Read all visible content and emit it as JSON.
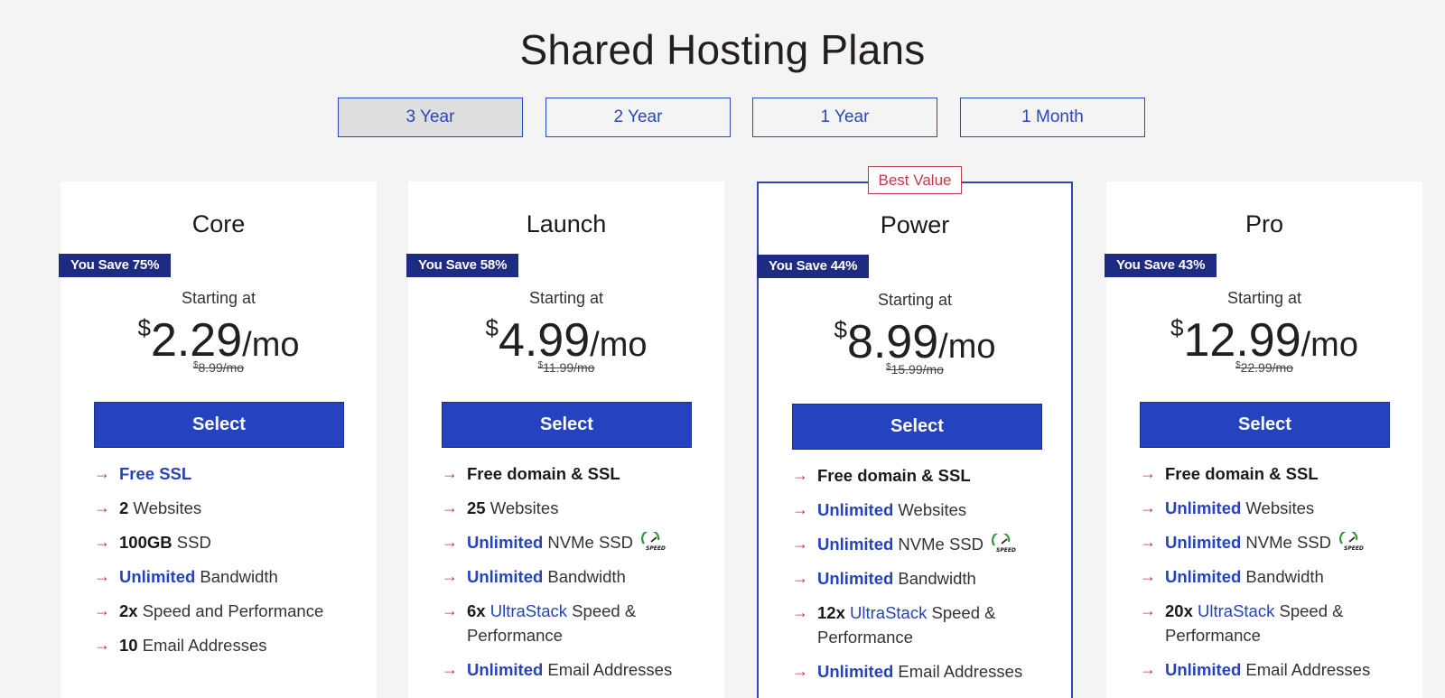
{
  "page_title": "Shared Hosting Plans",
  "terms": [
    "3 Year",
    "2 Year",
    "1 Year",
    "1 Month"
  ],
  "active_term": "3 Year",
  "best_value_label": "Best Value",
  "starting_label": "Starting at",
  "currency": "$",
  "per_label": "/mo",
  "select_label": "Select",
  "plans": [
    {
      "name": "Core",
      "save": "You Save 75%",
      "price": "2.29",
      "old_price": "8.99/mo",
      "features": [
        {
          "bold": "Free SSL",
          "bold_blue": true,
          "rest": ""
        },
        {
          "bold": "2",
          "bold_blue": false,
          "rest": " Websites"
        },
        {
          "bold": "100GB",
          "bold_blue": false,
          "rest": " SSD"
        },
        {
          "bold": "Unlimited",
          "bold_blue": true,
          "rest": " Bandwidth"
        },
        {
          "bold": "2x",
          "bold_blue": false,
          "rest": " Speed and Performance"
        },
        {
          "bold": "10",
          "bold_blue": false,
          "rest": " Email Addresses"
        }
      ]
    },
    {
      "name": "Launch",
      "save": "You Save 58%",
      "price": "4.99",
      "old_price": "11.99/mo",
      "features": [
        {
          "bold": "Free domain & SSL",
          "bold_blue": false,
          "rest": ""
        },
        {
          "bold": "25",
          "bold_blue": false,
          "rest": " Websites"
        },
        {
          "bold": "Unlimited",
          "bold_blue": true,
          "rest": " NVMe SSD",
          "speed_icon": true
        },
        {
          "bold": "Unlimited",
          "bold_blue": true,
          "rest": " Bandwidth"
        },
        {
          "bold": "6x",
          "bold_blue": false,
          "link": "UltraStack",
          "rest": " Speed & Performance"
        },
        {
          "bold": "Unlimited",
          "bold_blue": true,
          "rest": " Email Addresses"
        }
      ]
    },
    {
      "name": "Power",
      "save": "You Save 44%",
      "price": "8.99",
      "old_price": "15.99/mo",
      "featured": true,
      "features": [
        {
          "bold": "Free domain & SSL",
          "bold_blue": false,
          "rest": ""
        },
        {
          "bold": "Unlimited",
          "bold_blue": true,
          "rest": " Websites"
        },
        {
          "bold": "Unlimited",
          "bold_blue": true,
          "rest": " NVMe SSD",
          "speed_icon": true
        },
        {
          "bold": "Unlimited",
          "bold_blue": true,
          "rest": " Bandwidth"
        },
        {
          "bold": "12x",
          "bold_blue": false,
          "link": "UltraStack",
          "rest": " Speed & Performance"
        },
        {
          "bold": "Unlimited",
          "bold_blue": true,
          "rest": " Email Addresses"
        }
      ]
    },
    {
      "name": "Pro",
      "save": "You Save 43%",
      "price": "12.99",
      "old_price": "22.99/mo",
      "features": [
        {
          "bold": "Free domain & SSL",
          "bold_blue": false,
          "rest": ""
        },
        {
          "bold": "Unlimited",
          "bold_blue": true,
          "rest": " Websites"
        },
        {
          "bold": "Unlimited",
          "bold_blue": true,
          "rest": " NVMe SSD",
          "speed_icon": true
        },
        {
          "bold": "Unlimited",
          "bold_blue": true,
          "rest": " Bandwidth"
        },
        {
          "bold": "20x",
          "bold_blue": false,
          "link": "UltraStack",
          "rest": " Speed & Performance"
        },
        {
          "bold": "Unlimited",
          "bold_blue": true,
          "rest": " Email Addresses"
        }
      ]
    }
  ],
  "speed_icon_label": "SPEED",
  "icons": {
    "feature_arrow": "arrow-right-icon",
    "speed": "speed-gauge-icon"
  },
  "colors": {
    "accent_blue": "#2543bf",
    "navy_tag": "#1d2b80",
    "arrow_red": "#c23a47"
  }
}
